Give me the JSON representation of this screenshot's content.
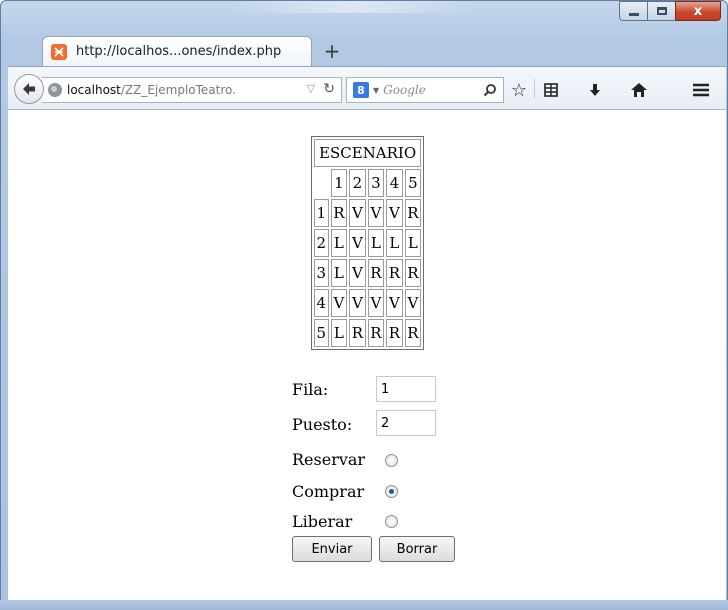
{
  "browser": {
    "tab_title": "http://localhos...ones/index.php",
    "new_tab_label": "+",
    "url_host": "localhost",
    "url_path": "/ZZ_EjemploTeatro.",
    "search_placeholder": "Google",
    "window_close_label": "x"
  },
  "stage": {
    "caption": "ESCENARIO",
    "column_headers": [
      "1",
      "2",
      "3",
      "4",
      "5"
    ],
    "rows": [
      {
        "label": "1",
        "seats": [
          "R",
          "V",
          "V",
          "V",
          "R"
        ]
      },
      {
        "label": "2",
        "seats": [
          "L",
          "V",
          "L",
          "L",
          "L"
        ]
      },
      {
        "label": "3",
        "seats": [
          "L",
          "V",
          "R",
          "R",
          "R"
        ]
      },
      {
        "label": "4",
        "seats": [
          "V",
          "V",
          "V",
          "V",
          "V"
        ]
      },
      {
        "label": "5",
        "seats": [
          "L",
          "R",
          "R",
          "R",
          "R"
        ]
      }
    ]
  },
  "form": {
    "fila_label": "Fila:",
    "fila_value": "1",
    "puesto_label": "Puesto:",
    "puesto_value": "2",
    "reservar_label": "Reservar",
    "comprar_label": "Comprar",
    "liberar_label": "Liberar",
    "selected_action": "Comprar",
    "submit_label": "Enviar",
    "reset_label": "Borrar"
  }
}
